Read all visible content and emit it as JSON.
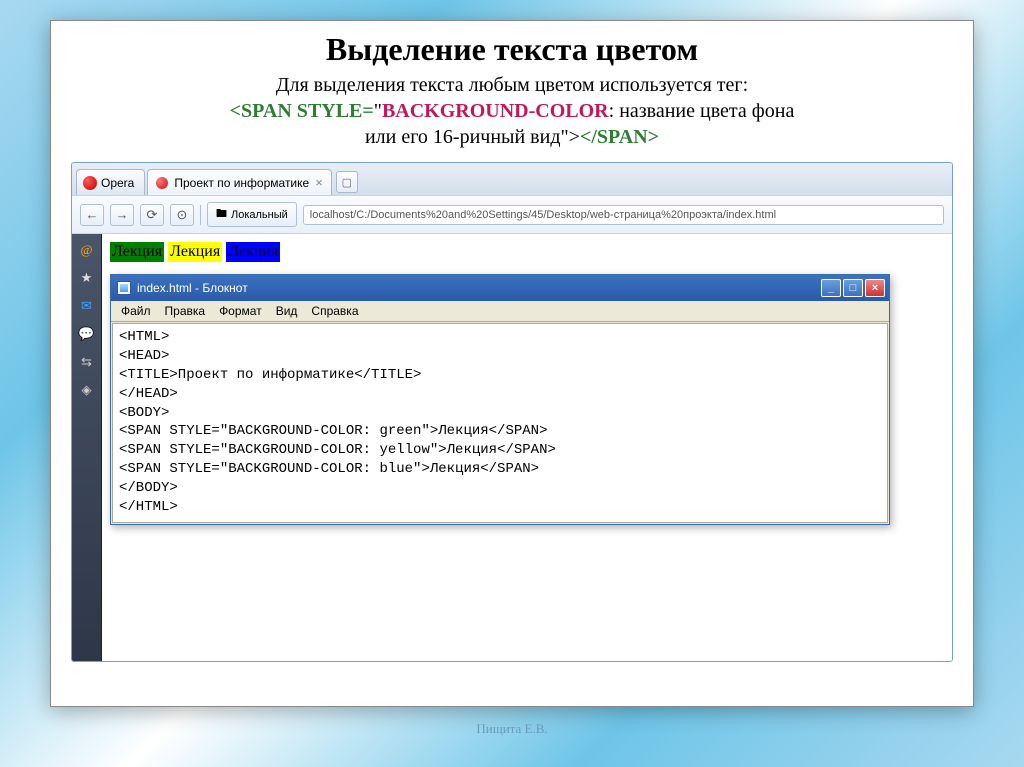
{
  "slide": {
    "title": "Выделение текста цветом",
    "desc": "Для выделения текста любым цветом используется тег:",
    "code": {
      "open_tag": "<SPAN STYLE=",
      "quote": "\"",
      "prop": "BACKGROUND-COLOR",
      "colon": ":",
      "val_text": " название цвета фона",
      "line2": "или его 16-ричный вид",
      "close_attr": "\">",
      "close_tag": "</SPAN>"
    }
  },
  "browser": {
    "opera_label": "Opera",
    "tab_title": "Проект по информатике",
    "local_label": "Локальный",
    "url": "localhost/C:/Documents%20and%20Settings/45/Desktop/web-страница%20проэкта/index.html"
  },
  "page_spans": {
    "green": "Лекция",
    "yellow": "Лекция",
    "blue": "Лекция"
  },
  "notepad": {
    "title": "index.html - Блокнот",
    "menu": [
      "Файл",
      "Правка",
      "Формат",
      "Вид",
      "Справка"
    ],
    "lines": [
      "<HTML>",
      "<HEAD>",
      "<TITLE>Проект по информатике</TITLE>",
      "</HEAD>",
      "<BODY>",
      "<SPAN STYLE=\"BACKGROUND-COLOR: green\">Лекция</SPAN>",
      "<SPAN STYLE=\"BACKGROUND-COLOR: yellow\">Лекция</SPAN>",
      "<SPAN STYLE=\"BACKGROUND-COLOR: blue\">Лекция</SPAN>",
      "</BODY>",
      "</HTML>"
    ]
  },
  "footer": "Пищита Е.В."
}
